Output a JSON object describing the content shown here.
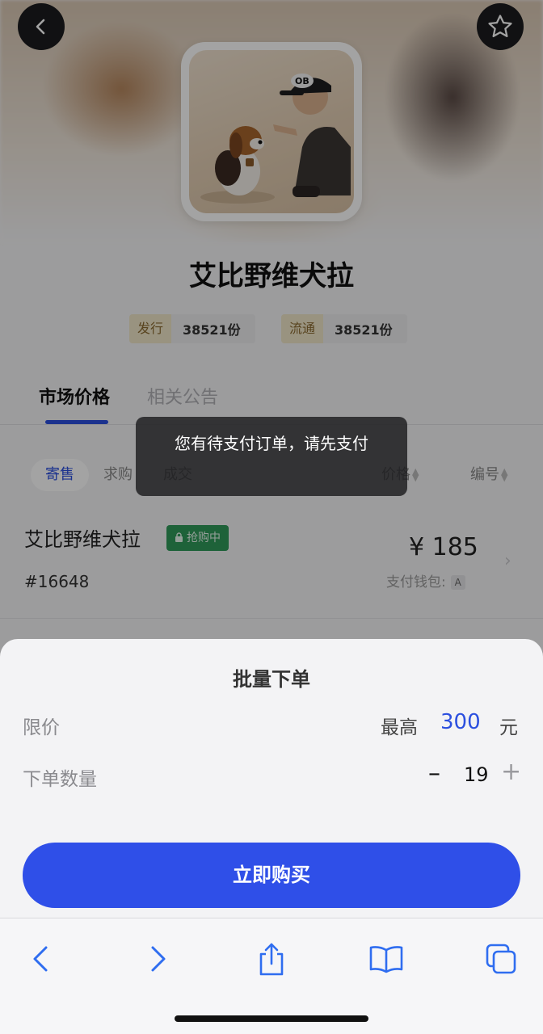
{
  "header": {
    "back_icon": "chevron-left-icon",
    "favorite_icon": "star-outline-icon"
  },
  "product": {
    "title": "艾比野维犬拉",
    "stats": [
      {
        "tag": "发行",
        "value": "38521份"
      },
      {
        "tag": "流通",
        "value": "38521份"
      }
    ]
  },
  "tabs": [
    {
      "label": "市场价格",
      "active": true
    },
    {
      "label": "相关公告",
      "active": false
    }
  ],
  "filters": {
    "segments": [
      "寄售",
      "求购",
      "成交"
    ],
    "active_segment": "寄售",
    "sort": [
      "价格",
      "编号"
    ]
  },
  "listing": {
    "name": "艾比野维犬拉",
    "badge": "抢购中",
    "badge_icon": "lock-icon",
    "id": "#16648",
    "price": "¥ 185",
    "wallet_label": "支付钱包:",
    "wallet_badge": "A"
  },
  "toast": {
    "message": "您有待支付订单，请先支付"
  },
  "sheet": {
    "title": "批量下单",
    "limit_label": "限价",
    "limit_prefix": "最高",
    "limit_value": "300",
    "limit_unit": "元",
    "quantity_label": "下单数量",
    "quantity_value": "19",
    "minus": "–",
    "plus": "+",
    "buy_button": "立即购买"
  },
  "colors": {
    "accent": "#2f4fe8",
    "badge_green": "#2f9a5a"
  },
  "browser_toolbar": [
    "back-icon",
    "forward-icon",
    "share-icon",
    "bookmarks-icon",
    "tabs-icon"
  ]
}
